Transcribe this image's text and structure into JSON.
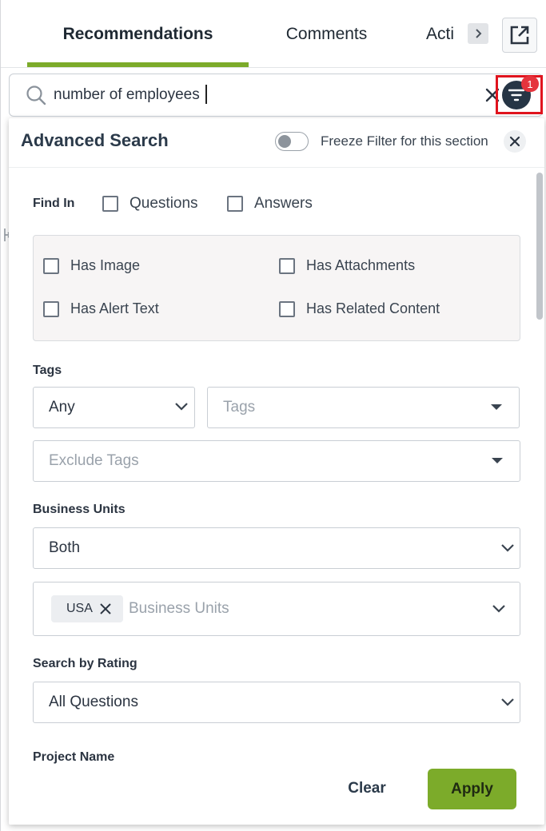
{
  "tabs": [
    {
      "label": "Recommendations",
      "active": true
    },
    {
      "label": "Comments",
      "active": false
    },
    {
      "label": "Acti",
      "active": false
    }
  ],
  "icons": {
    "tab_scroll": "chevron-right-icon",
    "popout": "external-link-icon",
    "search": "search-icon",
    "clear": "close-icon",
    "filter": "filter-icon",
    "panel_close": "close-icon",
    "dropdown": "chevron-down-icon",
    "select_caret": "caret-down-icon"
  },
  "search": {
    "value": "number of employees",
    "filter_badge": "1"
  },
  "advanced_search": {
    "title": "Advanced Search",
    "freeze_filter_label": "Freeze Filter for this section",
    "freeze_filter_on": false,
    "find_in": {
      "label": "Find In",
      "options": [
        {
          "label": "Questions",
          "checked": false
        },
        {
          "label": "Answers",
          "checked": false
        }
      ]
    },
    "content_filters": [
      {
        "label": "Has Image",
        "checked": false
      },
      {
        "label": "Has Attachments",
        "checked": false
      },
      {
        "label": "Has Alert Text",
        "checked": false
      },
      {
        "label": "Has Related Content",
        "checked": false
      }
    ],
    "tags": {
      "label": "Tags",
      "match_value": "Any",
      "tags_placeholder": "Tags",
      "exclude_placeholder": "Exclude Tags"
    },
    "business_units": {
      "label": "Business Units",
      "scope_value": "Both",
      "selected_chips": [
        "USA"
      ],
      "placeholder": "Business Units"
    },
    "rating": {
      "label": "Search by Rating",
      "value": "All Questions"
    },
    "project_name_label": "Project Name",
    "clear_label": "Clear",
    "apply_label": "Apply"
  },
  "colors": {
    "accent_green": "#7cab2a",
    "filter_button": "#263545",
    "badge_red": "#e5343d",
    "highlight_red": "#e0141e"
  }
}
